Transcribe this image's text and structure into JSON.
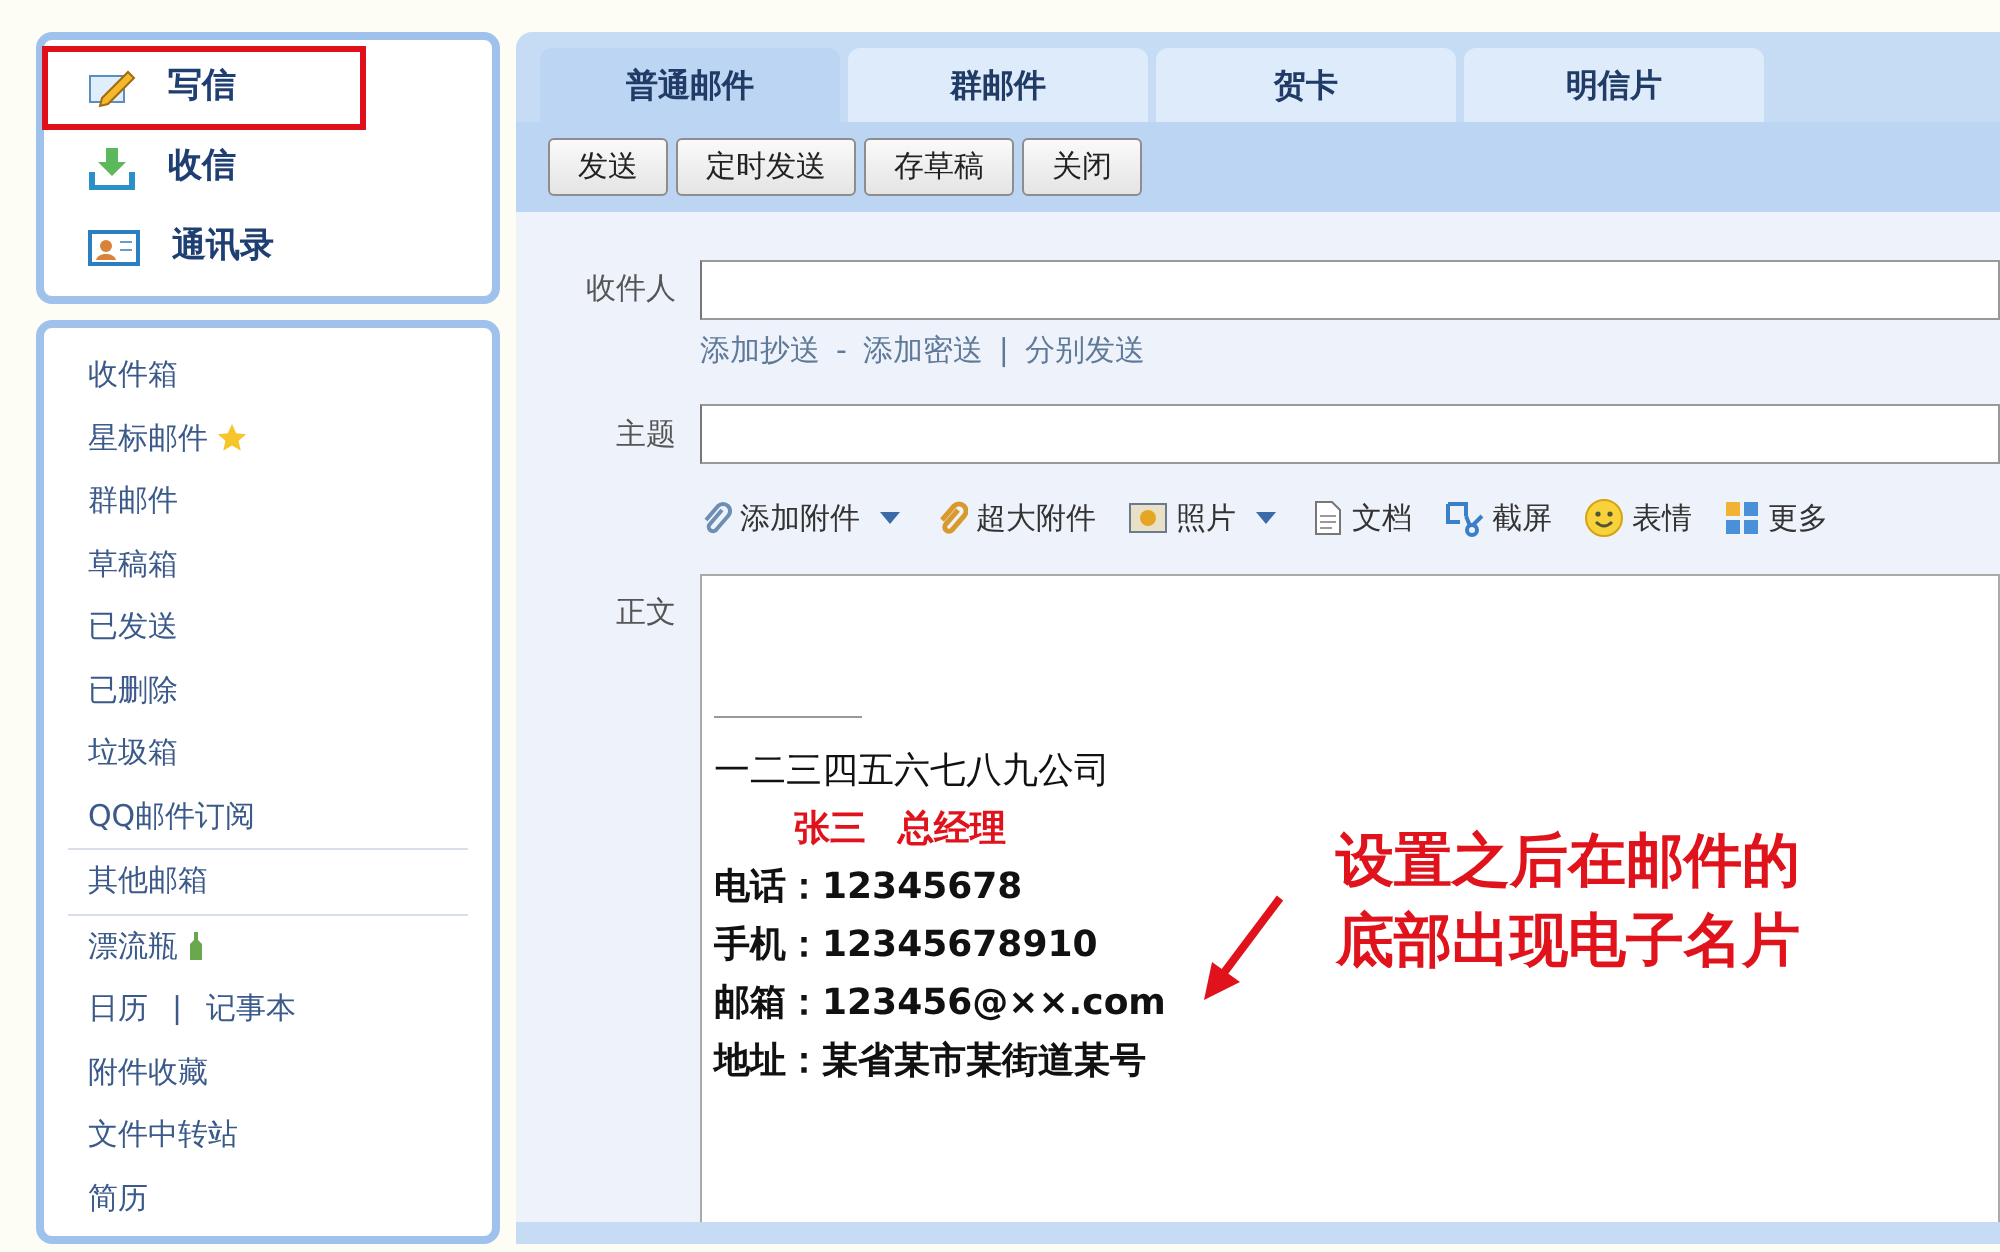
{
  "sidebar": {
    "actions": [
      {
        "label": "写信",
        "highlighted": true
      },
      {
        "label": "收信",
        "highlighted": false
      },
      {
        "label": "通讯录",
        "highlighted": false
      }
    ],
    "groups": [
      [
        {
          "label": "收件箱"
        },
        {
          "label": "星标邮件"
        },
        {
          "label": "群邮件"
        },
        {
          "label": "草稿箱"
        },
        {
          "label": "已发送"
        },
        {
          "label": "已删除"
        },
        {
          "label": "垃圾箱"
        },
        {
          "label": "QQ邮件订阅"
        }
      ],
      [
        {
          "label": "其他邮箱"
        }
      ],
      [
        {
          "label": "漂流瓶"
        },
        {
          "links": [
            "日历",
            "记事本"
          ],
          "separator": "|"
        },
        {
          "label": "附件收藏"
        },
        {
          "label": "文件中转站"
        },
        {
          "label": "简历"
        }
      ]
    ]
  },
  "tabs": [
    {
      "label": "普通邮件",
      "selected": true
    },
    {
      "label": "群邮件",
      "selected": false
    },
    {
      "label": "贺卡",
      "selected": false
    },
    {
      "label": "明信片",
      "selected": false
    }
  ],
  "buttons": [
    "发送",
    "定时发送",
    "存草稿",
    "关闭"
  ],
  "to_field": {
    "label": "收件人"
  },
  "recipient_links": [
    "添加抄送",
    "添加密送",
    "分别发送"
  ],
  "recipient_separators": [
    "-",
    "|"
  ],
  "subject_field": {
    "label": "主题"
  },
  "attach_toolbar": [
    {
      "label": "添加附件",
      "dropdown": true
    },
    {
      "label": "超大附件",
      "dropdown": false
    },
    {
      "label": "照片",
      "dropdown": true
    },
    {
      "label": "文档",
      "dropdown": false
    },
    {
      "label": "截屏",
      "dropdown": false
    },
    {
      "label": "表情",
      "dropdown": false
    },
    {
      "label": "更多",
      "dropdown": false
    }
  ],
  "body_field": {
    "label": "正文"
  },
  "signature": {
    "company": "一二三四五六七八九公司",
    "name": "张三",
    "title": "总经理",
    "lines": [
      "电话：12345678",
      "手机：12345678910",
      "邮箱：123456@××.com",
      "地址：某省某市某街道某号"
    ]
  },
  "annotation": {
    "lines": [
      "设置之后在邮件的",
      "底部出现电子名片"
    ]
  }
}
